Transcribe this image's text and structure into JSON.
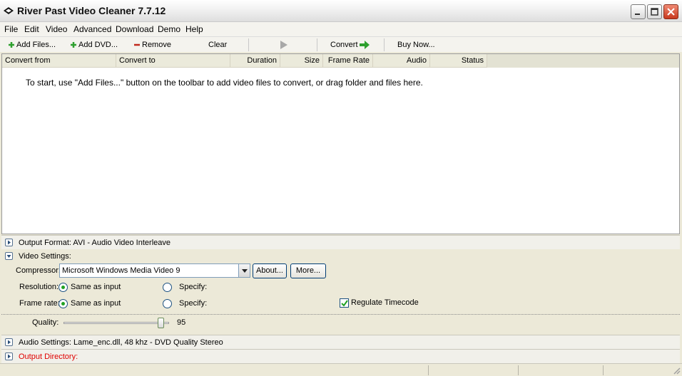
{
  "window": {
    "title": "River Past Video Cleaner 7.7.12"
  },
  "menu": [
    "File",
    "Edit",
    "Video",
    "Advanced",
    "Download",
    "Demo",
    "Help"
  ],
  "toolbar": {
    "add_files": "Add Files...",
    "add_dvd": "Add DVD...",
    "remove": "Remove",
    "clear": "Clear",
    "convert": "Convert",
    "buy_now": "Buy Now..."
  },
  "list": {
    "columns": [
      "Convert from",
      "Convert to",
      "Duration",
      "Size",
      "Frame Rate",
      "Audio",
      "Status"
    ],
    "hint": "To start, use \"Add Files...\" button on the toolbar to add video files to convert, or drag folder and files here."
  },
  "output_format": {
    "label": "Output Format: AVI - Audio Video Interleave"
  },
  "video_settings": {
    "label": "Video Settings:",
    "compressor_label": "Compressor:",
    "compressor_value": "Microsoft Windows Media Video 9",
    "about_button": "About...",
    "more_button": "More...",
    "resolution_label": "Resolution:",
    "resolution_same": "Same as input",
    "resolution_specify": "Specify:",
    "framerate_label": "Frame rate:",
    "framerate_same": "Same as input",
    "framerate_specify": "Specify:",
    "regulate_timecode": "Regulate Timecode",
    "quality_label": "Quality:",
    "quality_value": "95"
  },
  "audio_settings": {
    "label": "Audio Settings: Lame_enc.dll, 48 khz - DVD Quality Stereo"
  },
  "output_directory": {
    "label": "Output Directory:"
  },
  "colors": {
    "add_green": "#2ea02e",
    "remove_red": "#c0281c",
    "output_dir_red": "#e00000",
    "radio_dot": "#21a121"
  }
}
